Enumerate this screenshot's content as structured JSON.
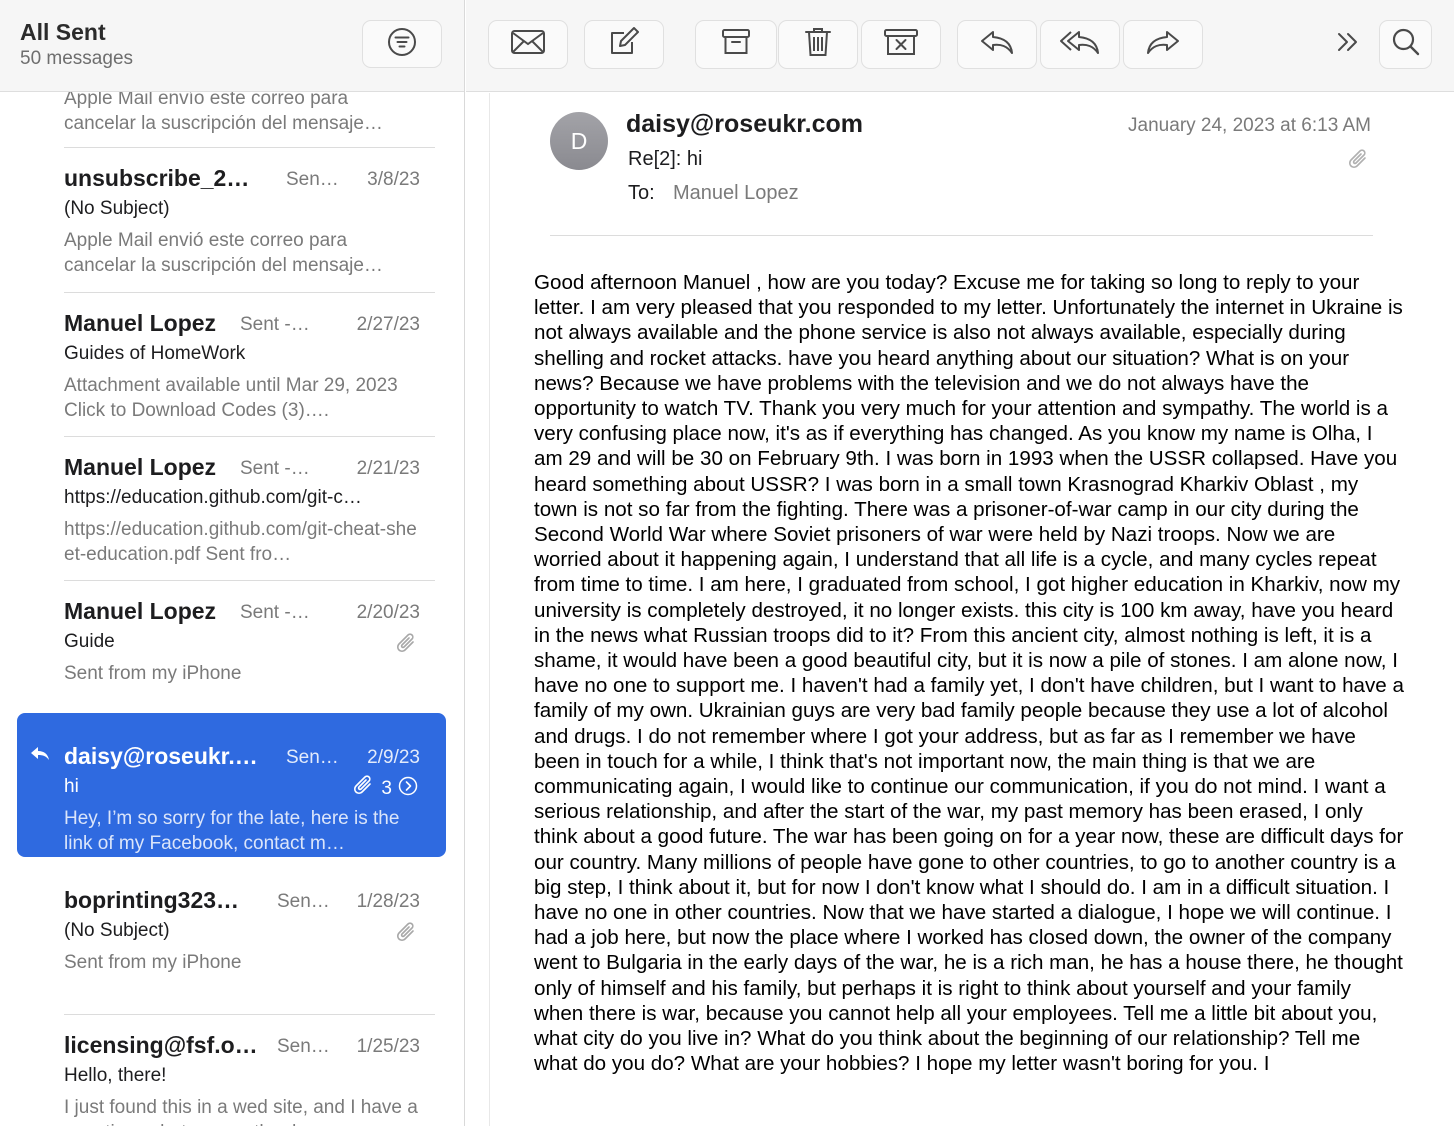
{
  "list_header": {
    "title": "All Sent",
    "count": "50 messages"
  },
  "messages": [
    {
      "sender": "",
      "mailbox": "",
      "date": "",
      "subject": "",
      "preview": "Apple Mail envío este correo para cancelar la suscripción del mensaje…"
    },
    {
      "sender": "unsubscribe_2…",
      "mailbox": "Sen…",
      "date": "3/8/23",
      "subject": "(No Subject)",
      "preview": "Apple Mail envió este correo para cancelar la suscripción del mensaje…"
    },
    {
      "sender": "Manuel Lopez",
      "mailbox": "Sent -…",
      "date": "2/27/23",
      "subject": "Guides of HomeWork",
      "preview": "Attachment available until Mar 29, 2023 Click to Download Codes (3)…."
    },
    {
      "sender": "Manuel Lopez",
      "mailbox": "Sent -…",
      "date": "2/21/23",
      "subject": "https://education.github.com/git-c…",
      "preview": "https://education.github.com/git-cheat-sheet-education.pdf Sent fro…"
    },
    {
      "sender": "Manuel Lopez",
      "mailbox": "Sent -…",
      "date": "2/20/23",
      "subject": "Guide",
      "preview": "Sent from my iPhone",
      "attachment": true
    },
    {
      "sender": "daisy@roseukr.…",
      "mailbox": "Sen…",
      "date": "2/9/23",
      "subject": "hi",
      "preview": "Hey, I’m so sorry for the late, here is the link of my Facebook, contact m…",
      "attachment": true,
      "thread_count": "3",
      "selected": true
    },
    {
      "sender": "boprinting323…",
      "mailbox": "Sen…",
      "date": "1/28/23",
      "subject": "(No Subject)",
      "preview": "Sent from my iPhone",
      "attachment": true
    },
    {
      "sender": "licensing@fsf.o…",
      "mailbox": "Sen…",
      "date": "1/25/23",
      "subject": "Hello, there!",
      "preview": "I just found this in a wed site, and I have a question, what means the dow…"
    }
  ],
  "toolbar": {
    "icons": [
      "filter-icon",
      "envelope-icon",
      "compose-icon",
      "archive-icon",
      "trash-icon",
      "junk-icon",
      "reply-icon",
      "reply-all-icon",
      "forward-icon",
      "more-icon",
      "search-icon"
    ]
  },
  "colors": {
    "selection": "#2f6ae0",
    "secondary_text": "#7a7a7a"
  },
  "email": {
    "avatar_letter": "D",
    "from": "daisy@roseukr.com",
    "subject": "Re[2]: hi",
    "to_label": "To:",
    "to": "Manuel Lopez",
    "date": "January 24, 2023 at 6:13 AM",
    "body": "Good afternoon Manuel , how are you today? Excuse me for taking so long to reply to your letter. I am very pleased that you responded to my letter. Unfortunately the internet in Ukraine is not always available and the phone service is also not always available, especially during shelling and rocket attacks. have you heard anything about our situation? What is on your news? Because we have problems with the television and we do not always have the opportunity to watch TV. Thank you very much for your attention and sympathy. The world is a very confusing place now, it's as if everything has changed. As you know my name is Olha, I am 29 and will be 30 on February 9th. I was born in 1993 when the USSR collapsed. Have you heard something about USSR? I was born in a small town Krasnograd Kharkiv Oblast , my town is not so far from the fighting. There was a prisoner-of-war camp in our city during the Second World War where Soviet prisoners of war were held by Nazi troops. Now we are worried about it happening again, I understand that all life is a cycle, and many cycles repeat from time to time. I am here, I graduated from school, I got higher education in Kharkiv, now my university is completely destroyed, it no longer exists. this city is 100 km away, have you heard in the news what Russian troops did to it? From this ancient city, almost nothing is left, it is a shame, it would have been a good beautiful city, but it is now a pile of stones. I am alone now, I have no one to support me. I haven't had a family yet, I don't have children, but I want to have a family of my own. Ukrainian guys are very bad family people because they use a lot of alcohol and drugs. I do not remember where I got your address, but as far as I remember we have been in touch for a while, I think that's not important now, the main thing is that we are communicating again, I would like to continue our communication, if you do not mind. I want a serious relationship, and after the start of the war, my past memory has been erased, I only think about a good future. The war has been going on for a year now, these are difficult days for our country. Many millions of people have gone to other countries, to go to another country is a big step, I think about it, but for now I don't know what I should do. I am in a difficult situation. I have no one in other countries. Now that we have started a dialogue, I hope we will continue. I had a job here, but now the place where I worked has closed down, the owner of the company went to Bulgaria in the early days of the war, he is a rich man, he has a house there, he thought only of himself and his family, but perhaps it is right to think about yourself and your family when there is war, because you cannot help all your employees. Tell me a little bit about you, what city do you live in? What do you think about the beginning of our relationship? Tell me what do you do? What are your hobbies? I hope my letter wasn't boring for you. I"
  }
}
